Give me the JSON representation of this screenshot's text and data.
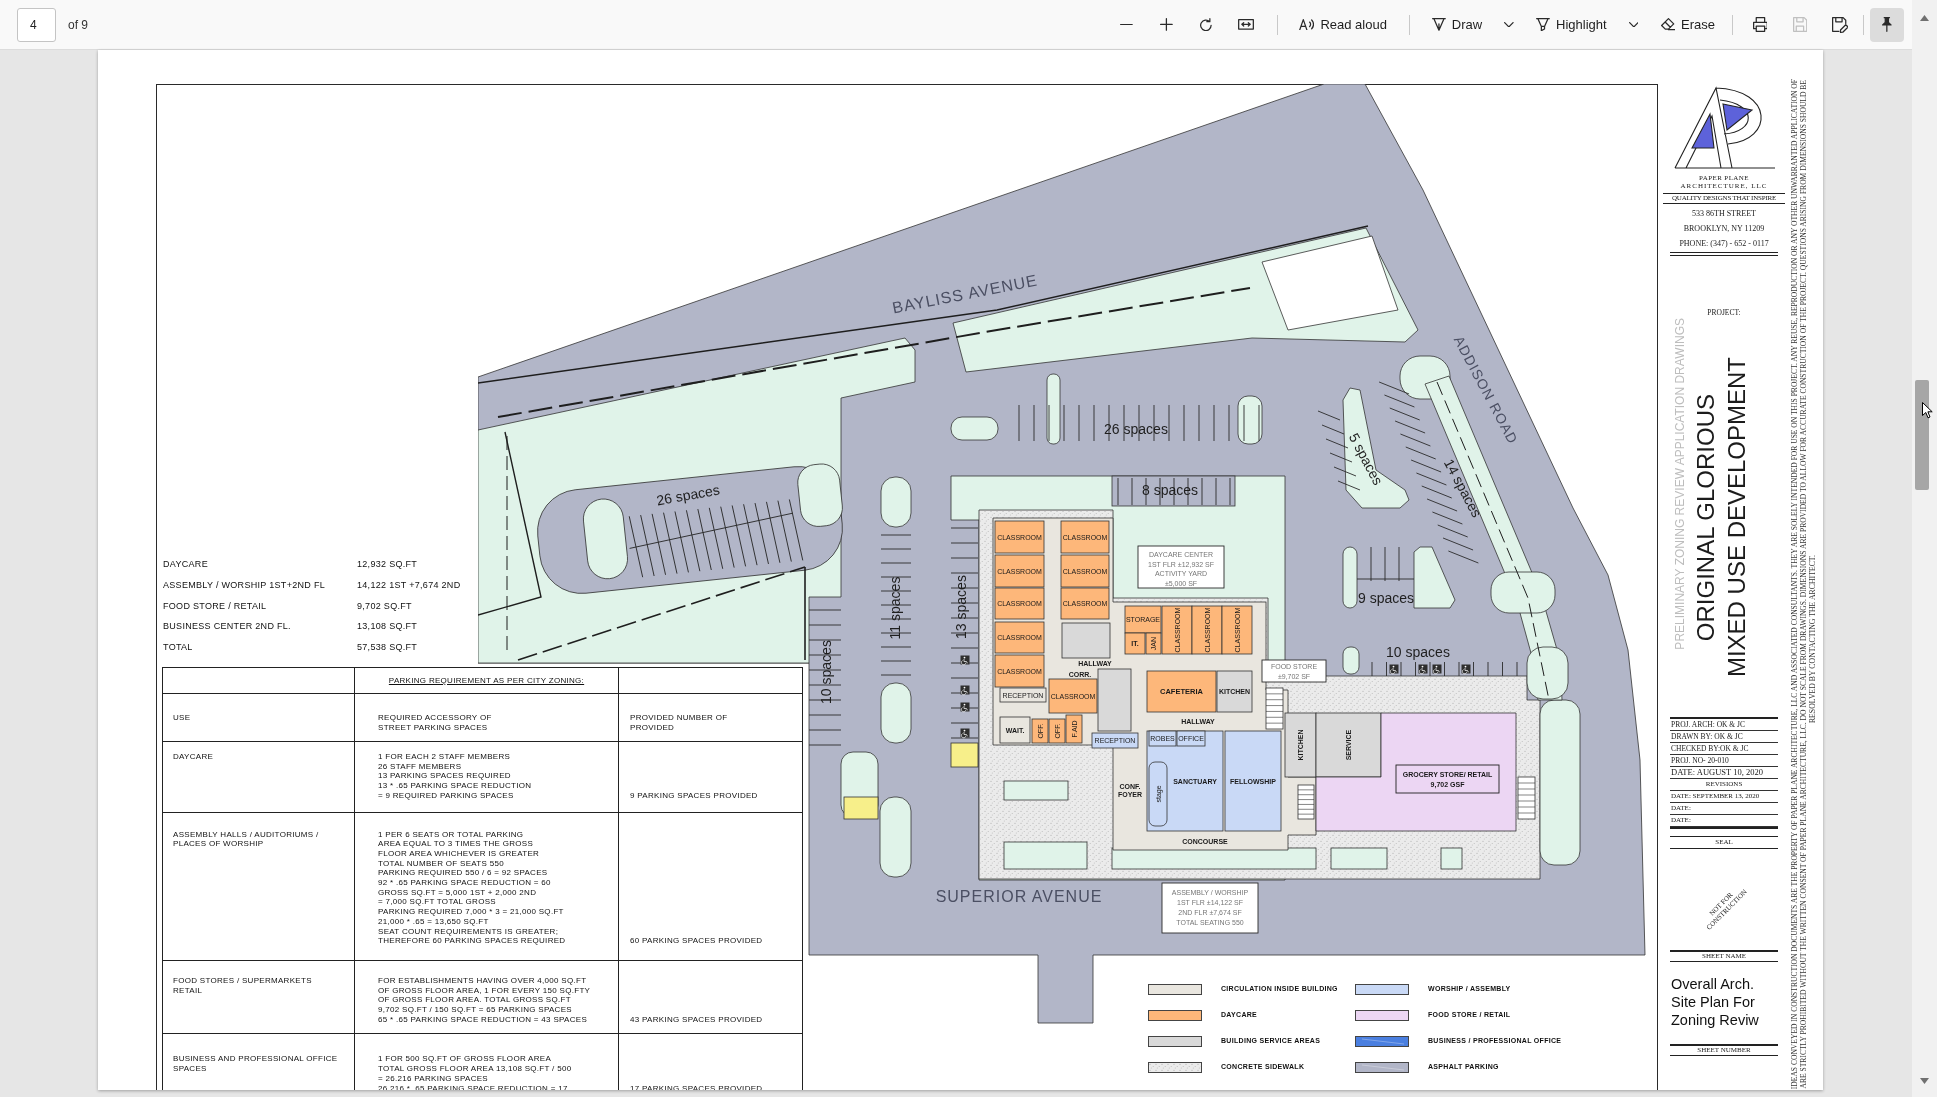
{
  "toolbar": {
    "page_field": {
      "value": "4"
    },
    "page_count": "of 9",
    "groups": [
      [
        {
          "kind": "zoom_out",
          "disabled": false,
          "on": false
        },
        {
          "kind": "zoom_in",
          "disabled": false,
          "on": false
        },
        {
          "kind": "rotate",
          "disabled": false,
          "on": false
        },
        {
          "kind": "fit",
          "disabled": false,
          "on": false
        }
      ],
      [
        {
          "kind": "read_aloud",
          "label": "Read aloud",
          "disabled": false,
          "on": false
        }
      ],
      [
        {
          "kind": "draw",
          "label": "Draw",
          "disabled": false,
          "on": false
        },
        {
          "kind": "options",
          "disabled": false,
          "on": false
        },
        {
          "kind": "highlight",
          "label": "Highlight",
          "disabled": false,
          "on": false
        },
        {
          "kind": "options",
          "disabled": false,
          "on": false
        },
        {
          "kind": "erase",
          "label": "Erase",
          "disabled": false,
          "on": false
        }
      ],
      [
        {
          "kind": "print",
          "disabled": false,
          "on": false
        },
        {
          "kind": "save",
          "disabled": true,
          "on": false
        },
        {
          "kind": "save_as",
          "disabled": false,
          "on": false
        }
      ],
      [
        {
          "kind": "pin",
          "disabled": false,
          "on": true
        }
      ]
    ]
  },
  "sheet": {
    "area_summary": [
      {
        "use": "DAYCARE",
        "area": "12,932 SQ.FT"
      },
      {
        "use": "ASSEMBLY / WORSHIP 1ST+2ND FL",
        "area": "14,122 1ST +7,674 2ND"
      },
      {
        "use": "FOOD STORE / RETAIL",
        "area": "9,702 SQ.FT"
      },
      {
        "use": "BUSINESS CENTER 2ND FL.",
        "area": "13,108 SQ.FT"
      },
      {
        "use": "TOTAL",
        "area": "57,538 SQ.FT"
      }
    ],
    "parking_table": {
      "title": "PARKING REQUIREMENT AS PER CITY ZONING:",
      "columns": [
        "USE",
        "REQUIRED ACCESSORY OF\nSTREET PARKING SPACES",
        "PROVIDED NUMBER OF\nPROVIDED"
      ],
      "rows": [
        {
          "use": "DAYCARE",
          "required": "1 FOR EACH 2 STAFF MEMBERS\n26 STAFF MEMBERS\n13 PARKING SPACES REQUIRED\n13 * .65 PARKING SPACE REDUCTION\n= 9 REQUIRED PARKING SPACES",
          "provided": "9 PARKING SPACES PROVIDED"
        },
        {
          "use": "ASSEMBLY HALLS / AUDITORIUMS /\nPLACES OF WORSHIP",
          "required": "1 PER 6 SEATS OR TOTAL PARKING\nAREA EQUAL TO 3 TIMES THE GROSS\nFLOOR AREA WHICHEVER IS GREATER\nTOTAL NUMBER OF SEATS 550\nPARKING REQUIRED 550 / 6 = 92 SPACES\n92 * .65 PARKING SPACE REDUCTION = 60\nGROSS SQ.FT = 5,000 1ST + 2,000 2ND\n= 7,000 SQ.FT TOTAL GROSS\nPARKING REQUIRED 7,000 * 3 = 21,000 SQ.FT\n21,000 * .65 = 13,650 SQ.FT\nSEAT COUNT REQUIREMENTS IS GREATER;\nTHEREFORE 60 PARKING SPACES REQUIRED",
          "provided": "60 PARKING SPACES PROVIDED"
        },
        {
          "use": "FOOD STORES / SUPERMARKETS\nRETAIL",
          "required": "FOR ESTABLISHMENTS HAVING OVER 4,000 SQ.FT\nOF GROSS FLOOR AREA, 1 FOR EVERY 150 SQ.FTY\nOF GROSS FLOOR AREA. TOTAL GROSS SQ.FT\n9,702 SQ.FT / 150 SQ.FT = 65 PARKING SPACES\n65 * .65 PARKING SPACE REDUCTION = 43 SPACES",
          "provided": "43 PARKING SPACES PROVIDED"
        },
        {
          "use": "BUSINESS AND PROFESSIONAL OFFICE\nSPACES",
          "required": "1 FOR 500 SQ.FT OF GROSS FLOOR AREA\nTOTAL GROSS FLOOR AREA 13,108 SQ.FT / 500\n= 26.216 PARKING SPACES\n26.216 * .65 PARKING SPACE REDUCTION = 17",
          "provided": "17 PARKING SPACES PROVIDED"
        }
      ]
    },
    "site_plan": {
      "streets": [
        "BAYLISS AVENUE",
        "ADDISON ROAD",
        "SUPERIOR AVENUE"
      ],
      "parking_counts": [
        "26 spaces",
        "26 spaces",
        "5 spaces",
        "8 spaces",
        "14 spaces",
        "11 spaces",
        "13 spaces",
        "9 spaces",
        "10 spaces",
        "10 spaces"
      ],
      "area_tags": [
        {
          "lines": [
            "DAYCARE CENTER",
            "1ST FLR ±12,932 SF",
            "ACTIVITY YARD",
            "±5,000 SF"
          ]
        },
        {
          "lines": [
            "FOOD STORE",
            "±9,702 SF"
          ]
        },
        {
          "lines": [
            "ASSEMBLY / WORSHIP",
            "1ST FLR ±14,122 SF",
            "2ND FLR ±7,674 SF",
            "TOTAL SEATING 550"
          ]
        }
      ],
      "rooms": [
        {
          "label": "CLASSROOM",
          "kind": "daycare"
        },
        {
          "label": "CLASSROOM",
          "kind": "daycare"
        },
        {
          "label": "CLASSROOM",
          "kind": "daycare"
        },
        {
          "label": "CLASSROOM",
          "kind": "daycare"
        },
        {
          "label": "CLASSROOM",
          "kind": "daycare"
        },
        {
          "label": "CLASSROOM",
          "kind": "daycare"
        },
        {
          "label": "CLASSROOM",
          "kind": "daycare"
        },
        {
          "label": "CLASSROOM",
          "kind": "daycare"
        },
        {
          "label": "STORAGE",
          "kind": "daycare"
        },
        {
          "label": "IT.",
          "kind": "daycare"
        },
        {
          "label": "JAN",
          "kind": "daycare"
        },
        {
          "label": "CLASSROOM",
          "kind": "daycare"
        },
        {
          "label": "CLASSROOM",
          "kind": "daycare"
        },
        {
          "label": "CLASSROOM",
          "kind": "daycare"
        },
        {
          "label": "RECEPTION",
          "kind": "circulation"
        },
        {
          "label": "CLASSROOM",
          "kind": "daycare"
        },
        {
          "label": "CAFETERIA",
          "kind": "daycare"
        },
        {
          "label": "KITCHEN",
          "kind": "service"
        },
        {
          "label": "WAIT.",
          "kind": "circulation"
        },
        {
          "label": "OFF.",
          "kind": "daycare"
        },
        {
          "label": "OFF.",
          "kind": "daycare"
        },
        {
          "label": "F.AID",
          "kind": "daycare"
        },
        {
          "label": "RECEPTION",
          "kind": "worship"
        },
        {
          "label": "SANCTUARY",
          "kind": "worship"
        },
        {
          "label": "FELLOWSHIP",
          "kind": "worship"
        },
        {
          "label": "ROBES",
          "kind": "worship"
        },
        {
          "label": "OFFICE",
          "kind": "worship"
        },
        {
          "label": "stage",
          "kind": "worship"
        },
        {
          "label": "KITCHEN",
          "kind": "service"
        },
        {
          "label": "SERVICE",
          "kind": "service"
        },
        {
          "label": "GROCERY STORE/ RETAIL",
          "area": "9,702 GSF",
          "kind": "retail"
        }
      ],
      "circulation_labels": [
        "HALLWAY",
        "CORR.",
        "HALLWAY",
        "CONF.\nFOYER",
        "CONCOURSE"
      ]
    },
    "legend": [
      {
        "label": "CIRCULATION INSIDE BUILDING",
        "kind": "circulation",
        "color": "#e9e6df"
      },
      {
        "label": "DAYCARE",
        "kind": "daycare",
        "color": "#fdb77a"
      },
      {
        "label": "BUILDING SERVICE AREAS",
        "kind": "service",
        "color": "#d9d9d9"
      },
      {
        "label": "CONCRETE SIDEWALK",
        "kind": "sidewalk",
        "color": "#ebebeb"
      },
      {
        "label": "WORSHIP / ASSEMBLY",
        "kind": "worship",
        "color": "#c9d9f6"
      },
      {
        "label": "FOOD STORE / RETAIL",
        "kind": "retail",
        "color": "#ecd6f3"
      },
      {
        "label": "BUSINESS / PROFESSIONAL OFFICE",
        "kind": "office",
        "color": "#4a7fe0"
      },
      {
        "label": "ASPHALT PARKING",
        "kind": "asphalt",
        "color": "#b2b6c8"
      }
    ],
    "title_block": {
      "firm_name": [
        "PAPER PLANE",
        "ARCHITECTURE, LLC"
      ],
      "tagline": "QUALITY DESIGNS THAT INSPIRE",
      "address": [
        "533 86TH STREET",
        "BROOKLYN, NY 11209",
        "PHONE: (347) - 652 - 0117"
      ],
      "project_label": "PROJECT:",
      "stage": "PRELIMINARY ZONING REVIEW APPLICATION DRAWINGS",
      "project_name": [
        "ORIGINAL GLORIOUS",
        "MIXED USE DEVELOPMENT"
      ],
      "fields": [
        "PROJ. ARCH: OK & JC",
        "DRAWN BY: OK & JC",
        "CHECKED BY:OK & JC",
        "PROJ. NO- 20-010"
      ],
      "date": "DATE: AUGUST 10, 2020",
      "revisions_label": "REVISIONS",
      "revisions": [
        "DATE: SEPTEMBER 13, 2020",
        "DATE:",
        "DATE:"
      ],
      "seal_label": "SEAL",
      "stamp": "NOT FOR\nCONSTRUCTION",
      "sheet_name_label": "SHEET NAME",
      "sheet_name": "Overall Arch.\nSite Plan For\nZoning Reviw",
      "sheet_number_label": "SHEET NUMBER",
      "disclaimer": [
        "IDEAS CONVEYED IN CONSTRUCTION DOCUMENTS ARE THE PROPERTY OF PAPER PLANE ARCHITECTURE, LLC AND ASSOCIATED CONSULTANTS. THEY ARE SOLELY INTENDED FOR USE ON THIS PROJECT. ANY REUSE, REPRODUCTION OR ANY OTHER UNWARRANTED APPLICATION OF",
        "ARE STRICTLY PROHIBITED WITHOUT THE WRITTEN CONSENT OF PAPER PLANE ARCHITECTURE, LLC. DO NOT SCALE FROM DRAWINGS. DIMENSIONS ARE PROVIDED TO ALLOW FOR ACCURATE CONSTRUCTION OF THE PROJECT. QUESTIONS ARISING FROM DIMENSIONS SHOULD BE",
        "RESOLVED BY CONTACTING THE ARCHITECT."
      ]
    }
  }
}
